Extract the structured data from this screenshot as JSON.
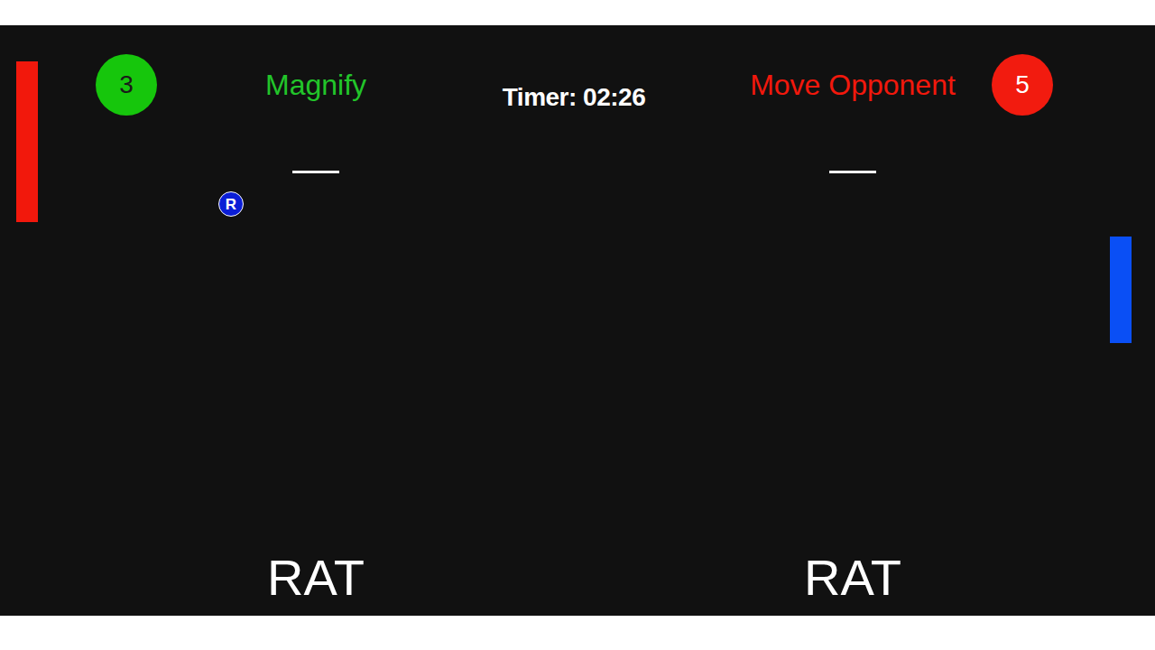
{
  "timer": "Timer: 02:26",
  "players": [
    {
      "score": "3",
      "score_color": "#16c60c",
      "score_text_color": "#1a1a1a",
      "power": "Magnify",
      "power_color": "#22c52a",
      "name": "RAT"
    },
    {
      "score": "5",
      "score_color": "#f21b0f",
      "score_text_color": "#ffffff",
      "power": "Move Opponent",
      "power_color": "#f2180c",
      "name": "RAT"
    }
  ],
  "paddles": [
    {
      "color": "#f2180c"
    },
    {
      "color": "#0a4ff5"
    }
  ],
  "ball": {
    "label": "R",
    "color": "#0b1ed6"
  }
}
